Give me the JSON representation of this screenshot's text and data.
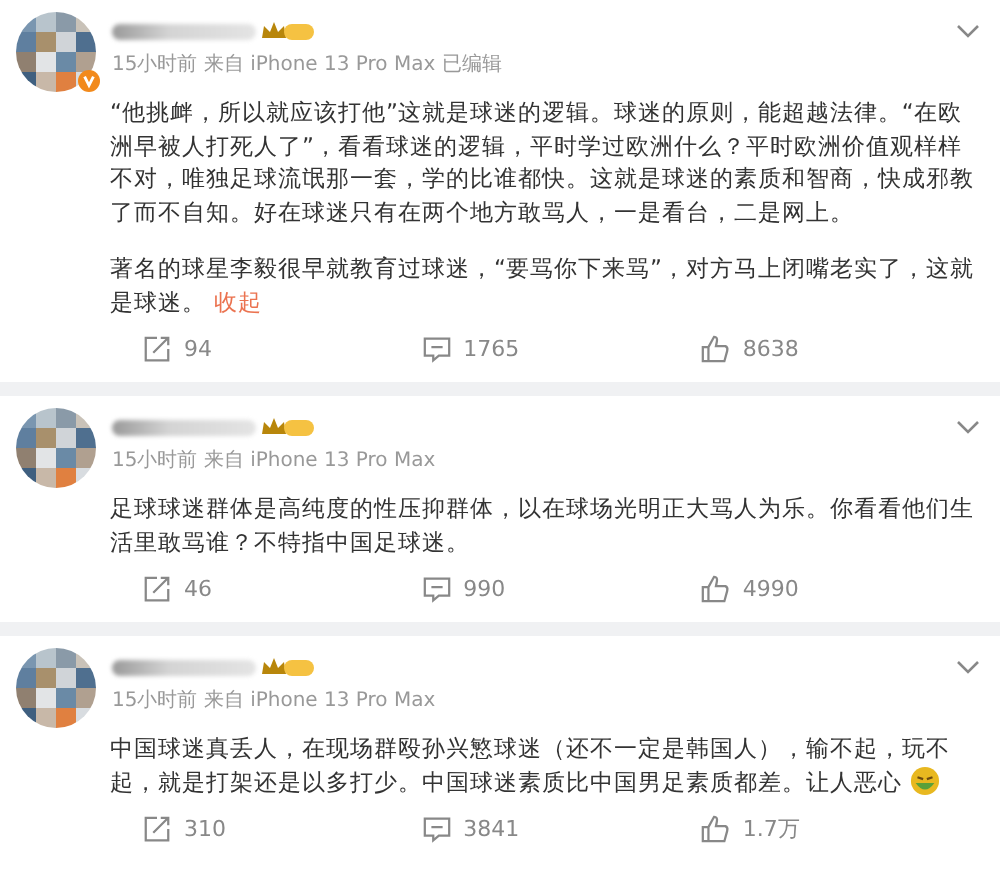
{
  "posts": [
    {
      "verified": true,
      "meta": "15小时前 来自 iPhone 13 Pro Max 已编辑",
      "paragraphs": [
        "“他挑衅，所以就应该打他”这就是球迷的逻辑。球迷的原则，能超越法律。“在欧洲早被人打死人了”，看看球迷的逻辑，平时学过欧洲什么？平时欧洲价值观样样不对，唯独足球流氓那一套，学的比谁都快。这就是球迷的素质和智商，快成邪教了而不自知。好在球迷只有在两个地方敢骂人，一是看台，二是网上。",
        "著名的球星李毅很早就教育过球迷，“要骂你下来骂”，对方马上闭嘴老实了，这就是球迷。"
      ],
      "collapse": "收起",
      "emoji": false,
      "reposts": "94",
      "comments": "1765",
      "likes": "8638"
    },
    {
      "verified": false,
      "meta": "15小时前 来自 iPhone 13 Pro Max",
      "paragraphs": [
        "足球球迷群体是高纯度的性压抑群体，以在球场光明正大骂人为乐。你看看他们生活里敢骂谁？不特指中国足球迷。"
      ],
      "emoji": false,
      "reposts": "46",
      "comments": "990",
      "likes": "4990"
    },
    {
      "verified": false,
      "meta": "15小时前 来自 iPhone 13 Pro Max",
      "paragraphs": [
        "中国球迷真丢人，在现场群殴孙兴慜球迷（还不一定是韩国人），输不起，玩不起，就是打架还是以多打少。中国球迷素质比中国男足素质都差。让人恶心"
      ],
      "emoji": true,
      "reposts": "310",
      "comments": "3841",
      "likes": "1.7万"
    }
  ]
}
